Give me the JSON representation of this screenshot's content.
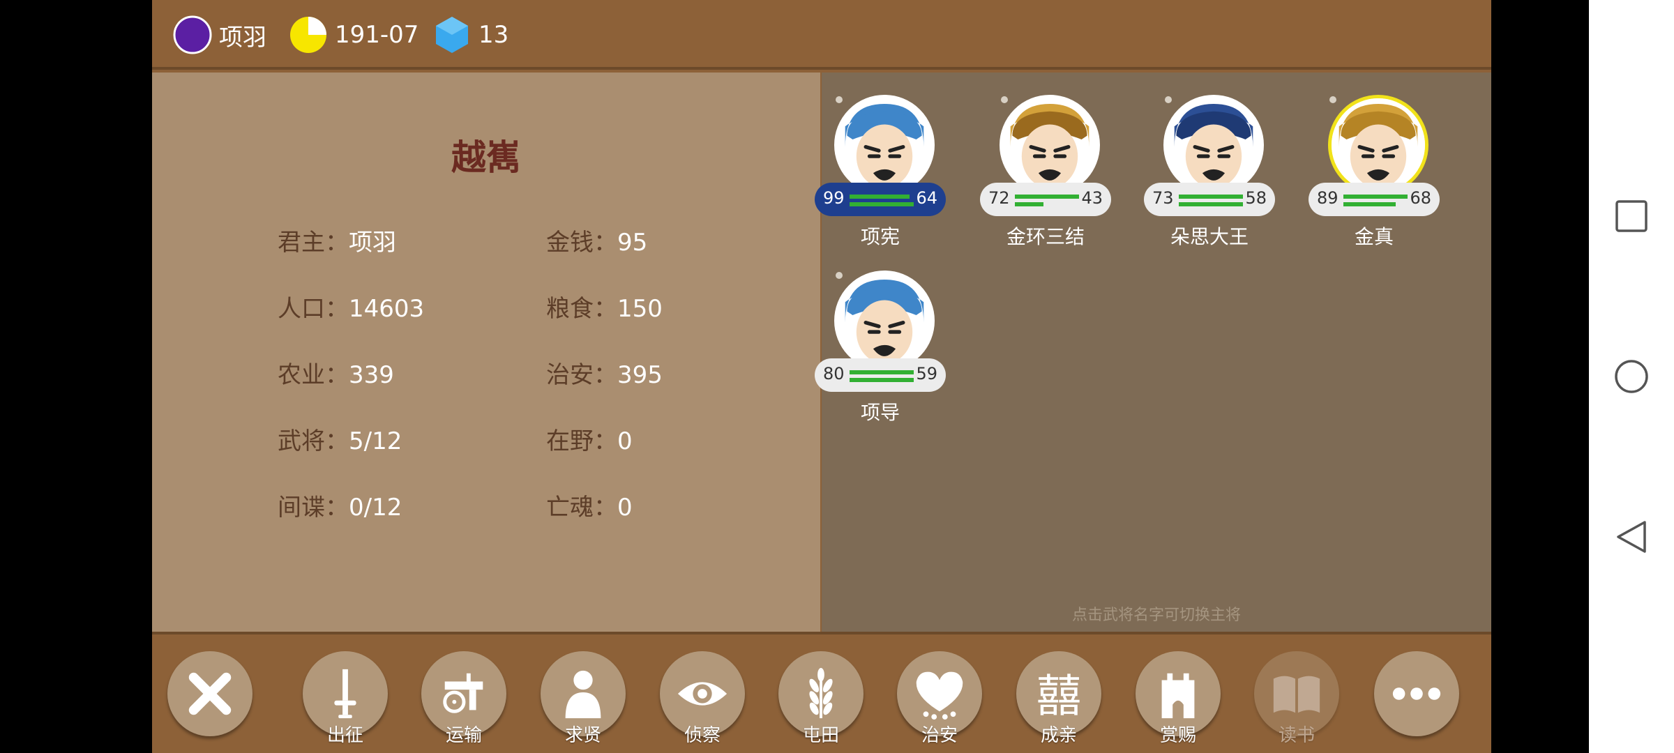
{
  "status": {
    "lord_name": "项羽",
    "lord_color": "#5b1fa3",
    "date": "191-07",
    "date_icon_color": "#f7e600",
    "gems": "13",
    "gem_color": "#3aa9ee"
  },
  "city": {
    "name": "越嶲",
    "fields": [
      {
        "label": "君主：",
        "value": "项羽"
      },
      {
        "label": "金钱：",
        "value": "95"
      },
      {
        "label": "人口：",
        "value": "14603"
      },
      {
        "label": "粮食：",
        "value": "150"
      },
      {
        "label": "农业：",
        "value": "339"
      },
      {
        "label": "治安：",
        "value": "395"
      },
      {
        "label": "武将：",
        "value": "5/12"
      },
      {
        "label": "在野：",
        "value": "0"
      },
      {
        "label": "间谍：",
        "value": "0/12"
      },
      {
        "label": "亡魂：",
        "value": "0"
      }
    ]
  },
  "generals": [
    {
      "name": "项宪",
      "stat_left": "99",
      "stat_right": "64",
      "bar_top": 0.94,
      "bar_bottom": 1.0,
      "selected": true,
      "gold": false,
      "helmet": "#3f86c9",
      "hair": "#3f86c9"
    },
    {
      "name": "金环三结",
      "stat_left": "72",
      "stat_right": "43",
      "bar_top": 1.0,
      "bar_bottom": 0.45,
      "selected": false,
      "gold": false,
      "helmet": "#d3a13a",
      "hair": "#9a6a1e"
    },
    {
      "name": "朵思大王",
      "stat_left": "73",
      "stat_right": "58",
      "bar_top": 1.0,
      "bar_bottom": 1.0,
      "selected": false,
      "gold": false,
      "helmet": "#2c4f95",
      "hair": "#1f3a74"
    },
    {
      "name": "金真",
      "stat_left": "89",
      "stat_right": "68",
      "bar_top": 1.0,
      "bar_bottom": 0.82,
      "selected": false,
      "gold": true,
      "helmet": "#d3a13a",
      "hair": "#b58425"
    },
    {
      "name": "项导",
      "stat_left": "80",
      "stat_right": "59",
      "bar_top": 1.0,
      "bar_bottom": 1.0,
      "selected": false,
      "gold": false,
      "helmet": "#3f86c9",
      "hair": "#3f86c9"
    }
  ],
  "hint": "点击武将名字可切换主将",
  "toolbar": {
    "close_icon": "close-icon",
    "buttons": [
      {
        "label": "出征",
        "icon": "sword-icon"
      },
      {
        "label": "运输",
        "icon": "cart-icon"
      },
      {
        "label": "求贤",
        "icon": "person-icon"
      },
      {
        "label": "侦察",
        "icon": "eye-icon"
      },
      {
        "label": "屯田",
        "icon": "wheat-icon"
      },
      {
        "label": "治安",
        "icon": "shield-heart-icon"
      },
      {
        "label": "成亲",
        "icon": "double-happiness-icon"
      },
      {
        "label": "赏赐",
        "icon": "tower-icon"
      },
      {
        "label": "读书",
        "icon": "book-icon",
        "disabled": true
      }
    ],
    "more_icon": "more-icon"
  }
}
